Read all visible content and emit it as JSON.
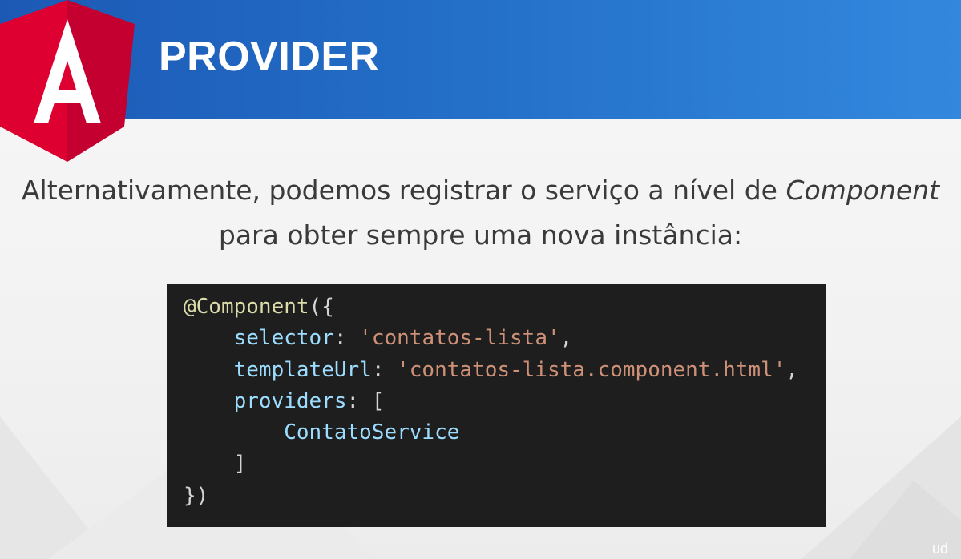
{
  "header": {
    "title": "PROVIDER",
    "logo_letter": "A",
    "logo_colors": {
      "left": "#dd0031",
      "right": "#c3002f",
      "letter": "#ffffff"
    },
    "bar_color_start": "#1c59b5",
    "bar_color_end": "#3388de"
  },
  "intro": {
    "line1_text": "Alternativamente, podemos registrar o serviço a nível de ",
    "line1_emphasis": "Component",
    "line2": "para obter sempre uma nova instância:"
  },
  "code": {
    "line1": {
      "decorator": "@Component",
      "punct": "({"
    },
    "line2": {
      "indent": "    ",
      "key": "selector",
      "colon": ": ",
      "value": "'contatos-lista'",
      "end": ","
    },
    "line3": {
      "indent": "    ",
      "key": "templateUrl",
      "colon": ": ",
      "value": "'contatos-lista.component.html'",
      "end": ","
    },
    "line4": {
      "indent": "    ",
      "key": "providers",
      "colon": ": ",
      "open": "["
    },
    "line5": {
      "indent": "        ",
      "identifier": "ContatoService"
    },
    "line6": {
      "indent": "    ",
      "close": "]"
    },
    "line7": {
      "close": "})"
    }
  },
  "watermark": "ud"
}
